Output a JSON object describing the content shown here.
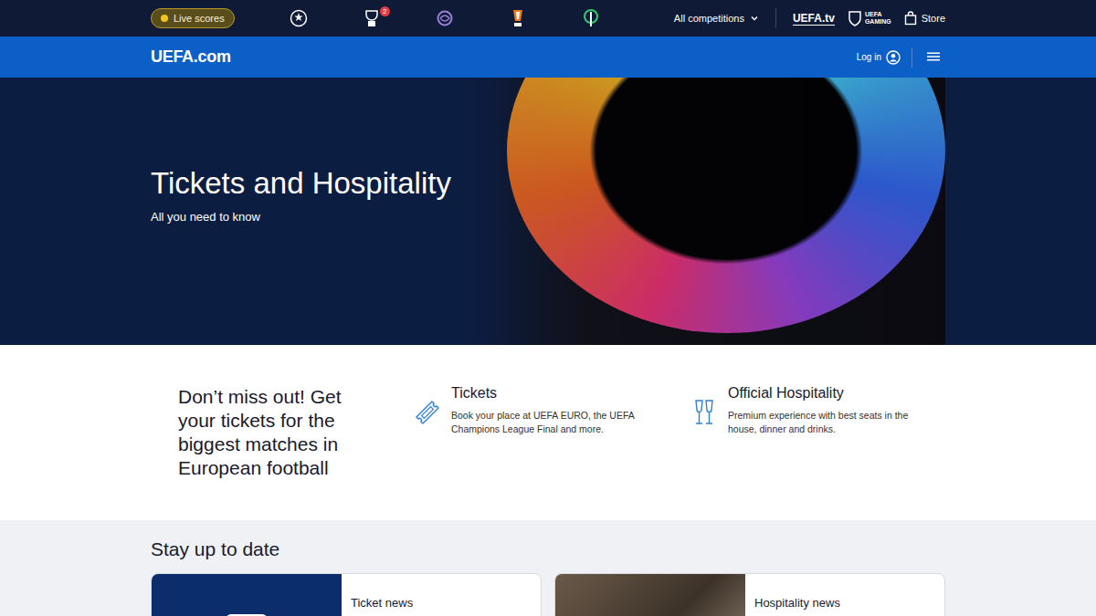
{
  "top_bar": {
    "live_scores": "Live scores",
    "competitions": [
      {
        "kind": "champions",
        "badge": null
      },
      {
        "kind": "youth",
        "badge": "2"
      },
      {
        "kind": "womens",
        "badge": null
      },
      {
        "kind": "europa",
        "badge": null
      },
      {
        "kind": "conference",
        "badge": null
      }
    ],
    "all_competitions": "All competitions",
    "uefa_tv": "UEFA.tv",
    "gaming": [
      "UEFA",
      "GAMING"
    ],
    "store": "Store"
  },
  "nav": {
    "logo": "UEFA.com",
    "login": "Log in"
  },
  "hero": {
    "title": "Tickets and Hospitality",
    "subtitle": "All you need to know"
  },
  "promo": {
    "heading": "Don’t miss out! Get your tickets for the biggest matches in European football",
    "features": [
      {
        "kind": "tickets",
        "title": "Tickets",
        "description": "Book your place at UEFA EURO, the UEFA Champions League Final and more."
      },
      {
        "kind": "hospitality",
        "title": "Official Hospitality",
        "description": "Premium experience with best seats in the house, dinner and drinks."
      }
    ]
  },
  "news": {
    "title": "Stay up to date",
    "cards": [
      {
        "kind": "tickets",
        "label": "Ticket news"
      },
      {
        "kind": "hospitality",
        "label": "Hospitality news"
      }
    ]
  }
}
